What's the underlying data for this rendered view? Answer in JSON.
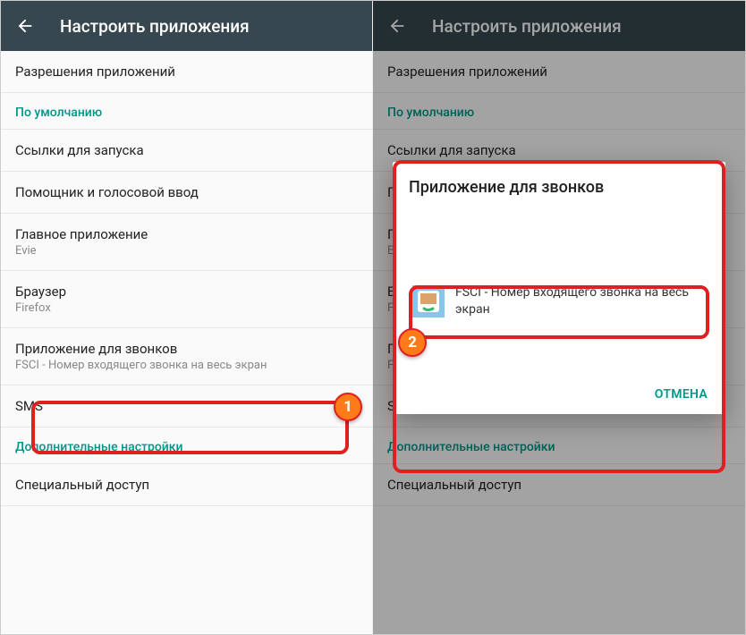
{
  "toolbar": {
    "title": "Настроить приложения"
  },
  "items": {
    "perms": "Разрешения приложений",
    "defaults_section": "По умолчанию",
    "launch_links": "Ссылки для запуска",
    "assistant": "Помощник и голосовой ввод",
    "home": {
      "title": "Главное приложение",
      "sub": "Evie"
    },
    "browser": {
      "title": "Браузер",
      "sub": "Firefox"
    },
    "calls": {
      "title": "Приложение для звонков",
      "sub": "FSCI - Номер входящего звонка на весь экран"
    },
    "sms": "SMS",
    "advanced_section": "Дополнительные настройки",
    "special": "Специальный доступ"
  },
  "dialog": {
    "title": "Приложение для звонков",
    "option": "FSCI - Номер входящего звонка на весь экран",
    "cancel": "ОТМЕНА"
  },
  "badges": {
    "one": "1",
    "two": "2"
  }
}
